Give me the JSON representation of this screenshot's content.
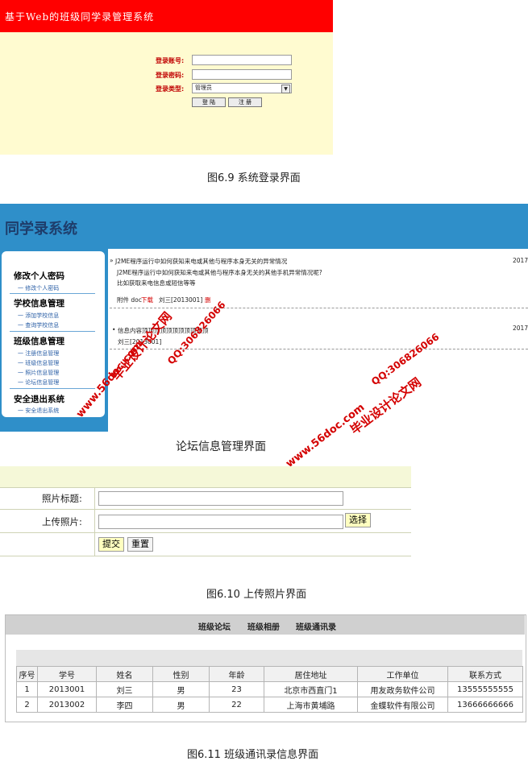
{
  "login": {
    "title": "基于Web的班级同学录管理系统",
    "account_label": "登录账号:",
    "password_label": "登录密码:",
    "type_label": "登录类型:",
    "type_value": "管理员",
    "login_button": "登 陆",
    "register_button": "注 册"
  },
  "captions": {
    "fig69": "图6.9  系统登录界面",
    "forum": "论坛信息管理界面",
    "fig610": "图6.10  上传照片界面",
    "fig611": "图6.11  班级通讯录信息界面"
  },
  "forum": {
    "title": "同学录系统",
    "sidebar": [
      {
        "heading": "修改个人密码",
        "items": [
          "一 修改个人密码"
        ]
      },
      {
        "heading": "学校信息管理",
        "items": [
          "一 添加学校信息",
          "一 查询学校信息"
        ]
      },
      {
        "heading": "班级信息管理",
        "items": [
          "一 注册信息管理",
          "一 班级信息管理",
          "一 照片信息管理",
          "一 论坛信息管理"
        ]
      },
      {
        "heading": "安全退出系统",
        "items": [
          "一 安全退出系统"
        ]
      }
    ],
    "post1": {
      "title": "J2ME程序运行中如何获知来电或其他与程序本身无关的异常情况",
      "line2": "J2ME程序运行中如何获知来电或其他与程序本身无关的其他手机异常情况呢?",
      "line3": "比如获取来电信息或短信等等",
      "attach_label": "附件 doc",
      "download": "下载",
      "author": "刘三[2013001]",
      "delete": "删",
      "date": "2017-"
    },
    "post2": {
      "title": "信息内容顶顶顶顶顶顶顶顶顶顶顶",
      "author": "刘三[2013001]",
      "date": "2017-"
    },
    "watermarks": {
      "site": "www.56doc.com",
      "qq": "QQ:306826066",
      "brand": "毕业设计论文网"
    }
  },
  "upload": {
    "title_label": "照片标题:",
    "file_label": "上传照片:",
    "choose_button": "选择",
    "submit_button": "提交",
    "reset_button": "重置"
  },
  "addressbook": {
    "nav": [
      "班级论坛",
      "班级相册",
      "班级通讯录"
    ],
    "columns": [
      "序号",
      "学号",
      "姓名",
      "性别",
      "年龄",
      "居住地址",
      "工作单位",
      "联系方式"
    ],
    "rows": [
      [
        "1",
        "2013001",
        "刘三",
        "男",
        "23",
        "北京市西直门1",
        "用友政务软件公司",
        "13555555555"
      ],
      [
        "2",
        "2013002",
        "李四",
        "男",
        "22",
        "上海市黄埔路",
        "金蝶软件有限公司",
        "13666666666"
      ]
    ]
  },
  "colors": {
    "login_header": "#ff0000",
    "login_body": "#fffbd0",
    "forum_blue": "#2f8fc9",
    "watermark": "#d40000"
  }
}
